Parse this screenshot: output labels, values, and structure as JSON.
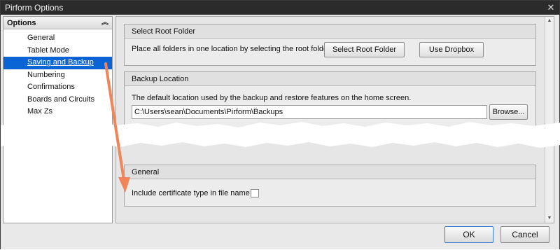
{
  "window": {
    "title": "Pirform Options",
    "close_glyph": "✕"
  },
  "sidebar": {
    "header": "Options",
    "collapse_glyph": "︽",
    "items": [
      {
        "label": "General"
      },
      {
        "label": "Tablet Mode"
      },
      {
        "label": "Saving and Backup",
        "selected": true
      },
      {
        "label": "Numbering"
      },
      {
        "label": "Confirmations"
      },
      {
        "label": "Boards and Circuits"
      },
      {
        "label": "Max Zs"
      }
    ]
  },
  "select_root": {
    "title": "Select Root Folder",
    "description": "Place all folders in one location by selecting the root folder",
    "select_button": "Select Root Folder",
    "dropbox_button": "Use Dropbox"
  },
  "backup": {
    "title": "Backup Location",
    "description": "The default location used by the backup and restore features on the home screen.",
    "path_value": "C:\\Users\\sean\\Documents\\Pirform\\Backups",
    "browse_button": "Browse..."
  },
  "general": {
    "title": "General",
    "cert_label": "Include certificate type in file name",
    "cert_checked": false
  },
  "footer": {
    "ok_label": "OK",
    "cancel_label": "Cancel"
  },
  "scrollbar": {
    "up_glyph": "▲",
    "down_glyph": "▼"
  },
  "colors": {
    "selection": "#0a64d6",
    "annotation_arrow": "#f0855a",
    "titlebar": "#2b2b2b"
  }
}
